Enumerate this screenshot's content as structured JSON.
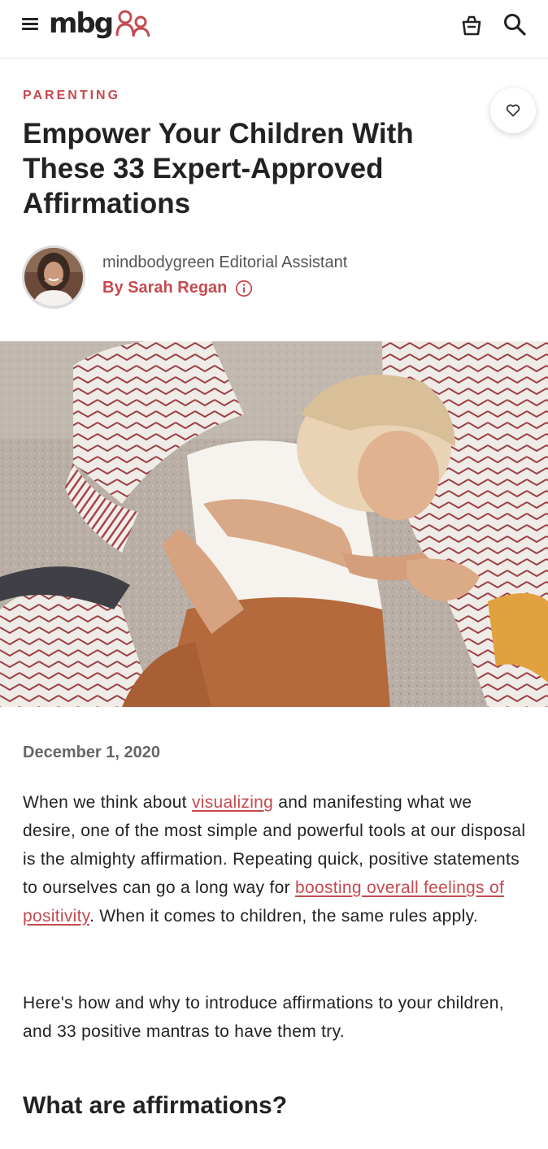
{
  "header": {
    "logo_text": "mbg",
    "menu_icon": "hamburger-menu-icon",
    "cart_icon": "shopping-bag-icon",
    "search_icon": "search-icon",
    "accent_color": "#c64a4f"
  },
  "article": {
    "category": "PARENTING",
    "title": "Empower Your Children With These 33 Expert-Approved Affirmations",
    "save_icon": "heart-icon",
    "author": {
      "role": "mindbodygreen Editorial Assistant",
      "name": "By Sarah Regan",
      "info_icon": "info-circle-icon"
    },
    "date": "December 1, 2020",
    "paragraph1": {
      "part1": "When we think about ",
      "link1": "visualizing",
      "part2": " and manifesting what we desire, one of the most simple and powerful tools at our disposal is the almighty affirmation. Repeating quick, positive statements to ourselves can go a long way for ",
      "link2": "boosting overall feelings of positivity",
      "part3": ". When it comes to children, the same rules apply."
    },
    "paragraph2": "Here's how and why to introduce affirmations to your children, and 33 positive mantras to have them try.",
    "section_heading": "What are affirmations?"
  }
}
